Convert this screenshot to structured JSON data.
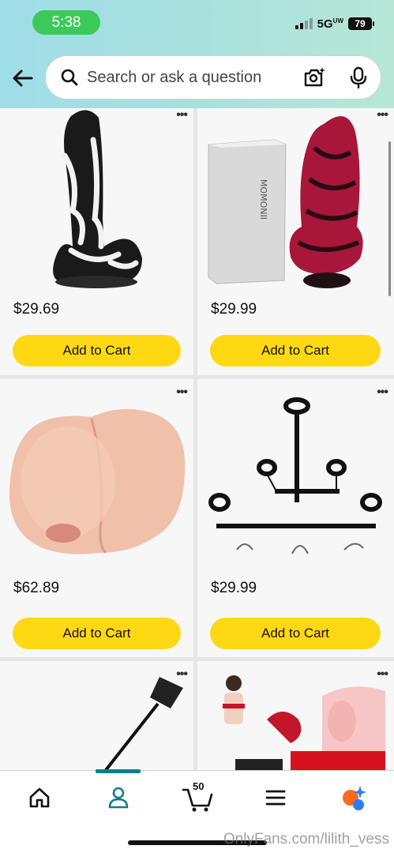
{
  "status_bar": {
    "time": "5:38",
    "network": "5G",
    "network_suffix": "UW",
    "battery": "79"
  },
  "search": {
    "placeholder": "Search or ask a question"
  },
  "products": [
    {
      "price": "$29.69",
      "button": "Add to Cart"
    },
    {
      "price": "$29.99",
      "button": "Add to Cart"
    },
    {
      "price": "$62.89",
      "button": "Add to Cart"
    },
    {
      "price": "$29.99",
      "button": "Add to Cart"
    }
  ],
  "more_menu": "•••",
  "tabbar": {
    "cart_count": "50"
  },
  "watermark": "OnlyFans.com/lilith_vess",
  "colors": {
    "accent": "#127d8a",
    "cart_button": "#ffd814",
    "time_pill": "#3cc95a"
  }
}
